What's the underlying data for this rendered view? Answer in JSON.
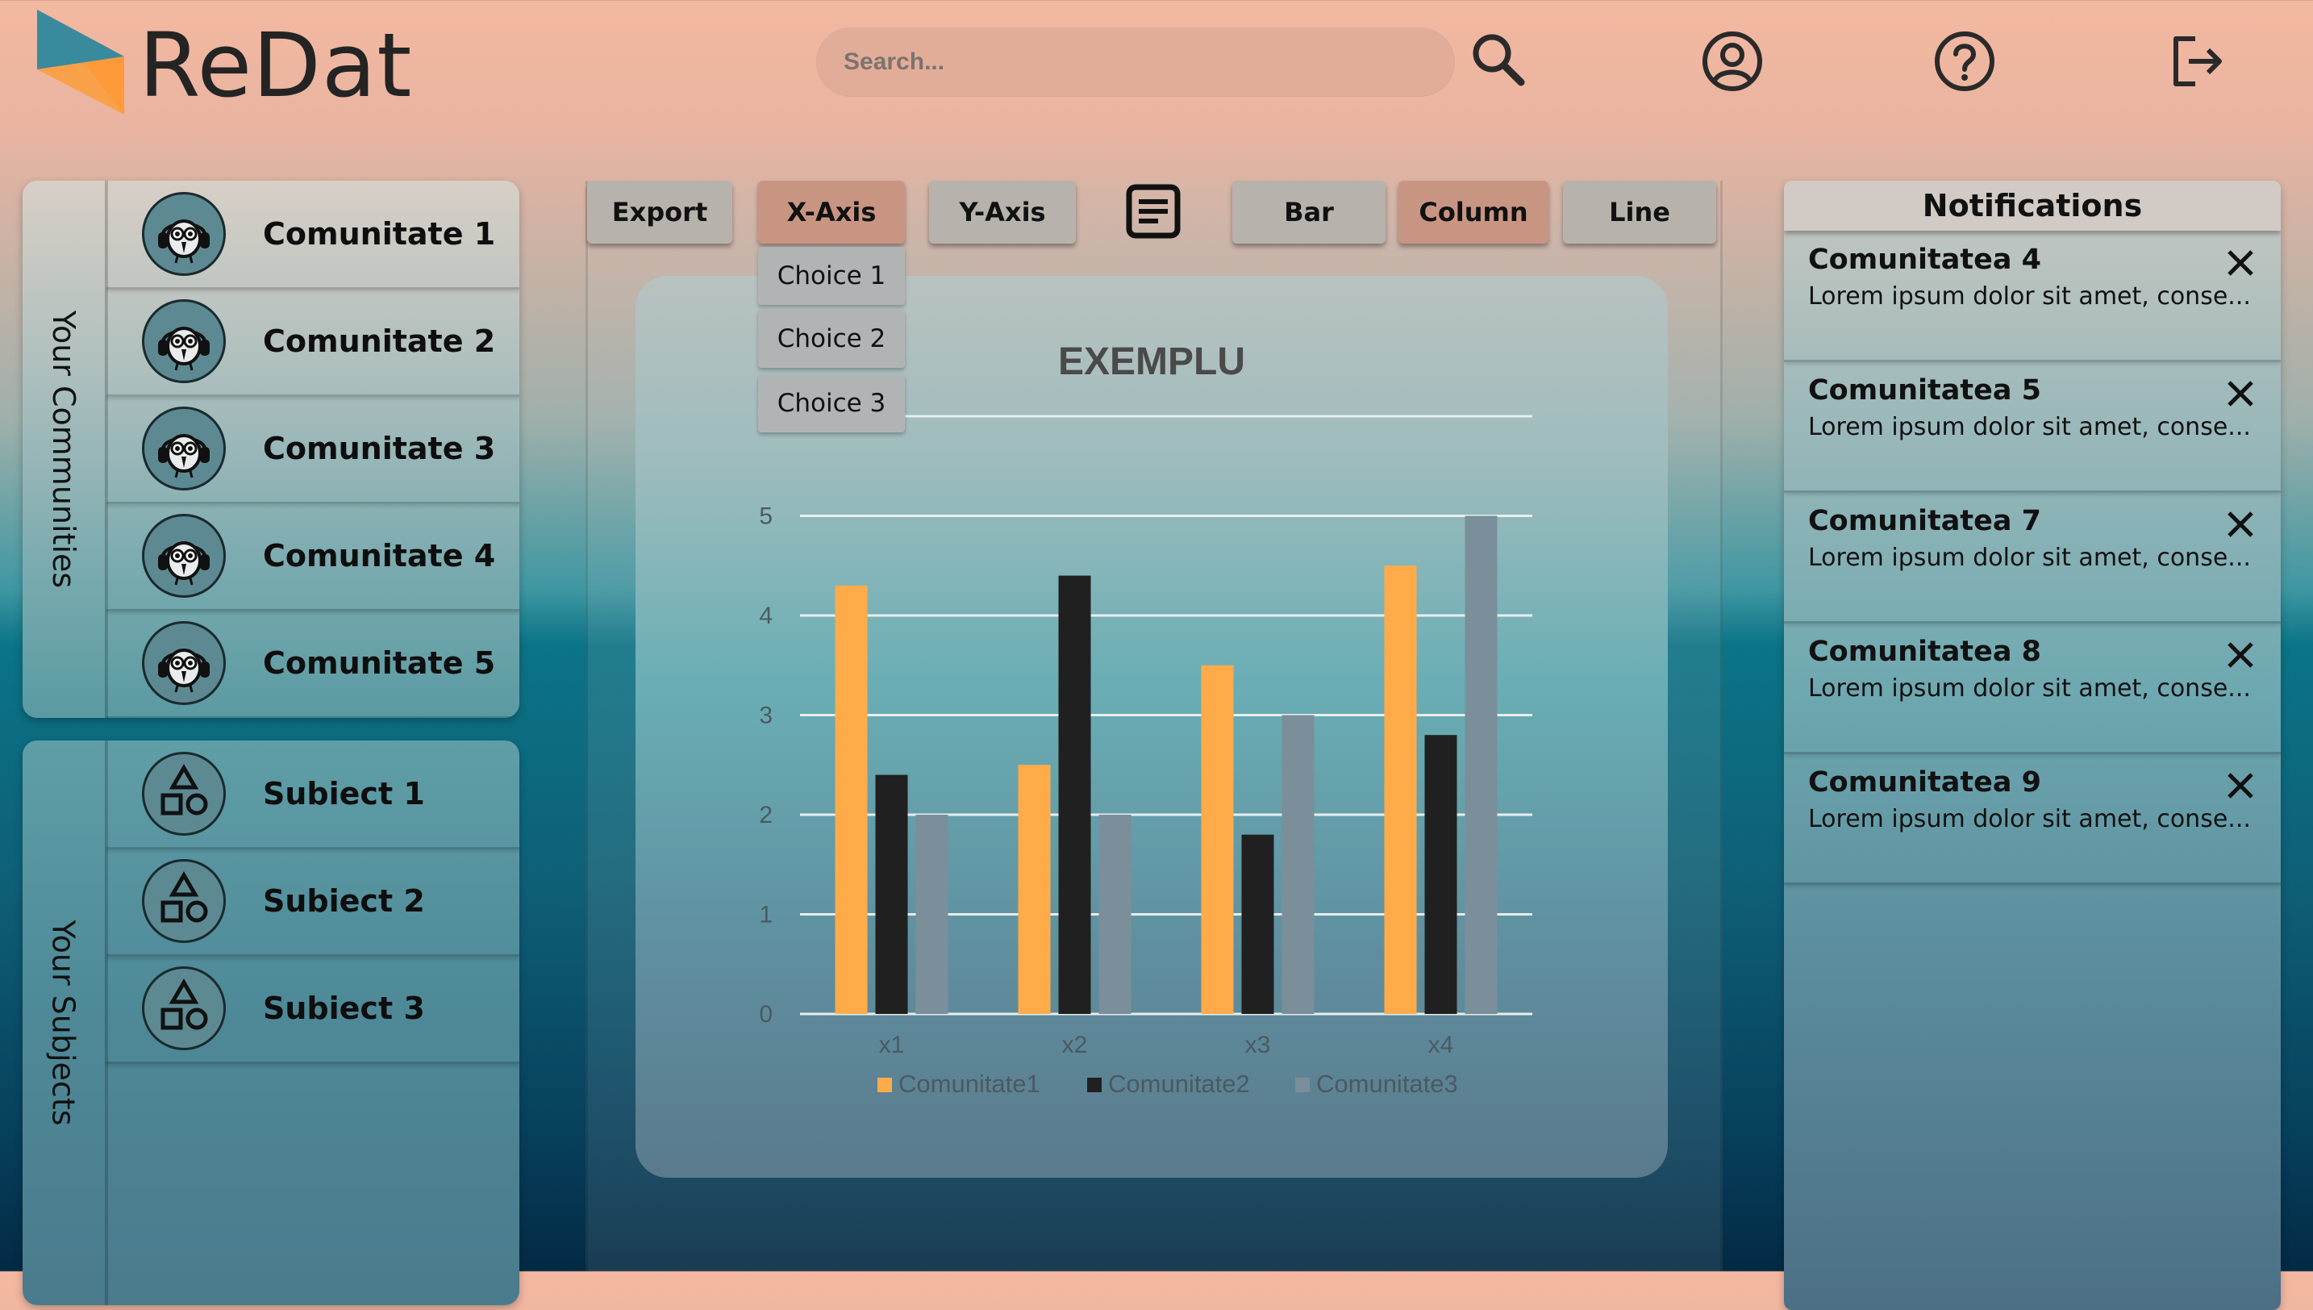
{
  "app": {
    "logo_text": "ReDat"
  },
  "header": {
    "search_placeholder": "Search...",
    "icons": [
      "search-icon",
      "user-profile-icon",
      "help-icon",
      "logout-icon"
    ]
  },
  "communities": {
    "title": "Your Communities",
    "items": [
      {
        "label": "Comunitate 1",
        "icon": "owl-headphones-icon"
      },
      {
        "label": "Comunitate 2",
        "icon": "owl-headphones-icon"
      },
      {
        "label": "Comunitate 3",
        "icon": "owl-headphones-icon"
      },
      {
        "label": "Comunitate 4",
        "icon": "owl-headphones-icon"
      },
      {
        "label": "Comunitate 5",
        "icon": "owl-headphones-icon"
      }
    ]
  },
  "subjects": {
    "title": "Your Subjects",
    "items": [
      {
        "label": "Subiect 1",
        "icon": "shapes-icon"
      },
      {
        "label": "Subiect 2",
        "icon": "shapes-icon"
      },
      {
        "label": "Subiect 3",
        "icon": "shapes-icon"
      }
    ]
  },
  "toolbar": {
    "export": "Export",
    "x_axis": "X-Axis",
    "y_axis": "Y-Axis",
    "bar": "Bar",
    "column": "Column",
    "line": "Line",
    "document_icon": "document-icon",
    "dropdown": [
      "Choice 1",
      "Choice 2",
      "Choice 3"
    ]
  },
  "notifications": {
    "title": "Notifications",
    "items": [
      {
        "title": "Comunitatea 4",
        "text": "Lorem ipsum dolor sit amet, conse..."
      },
      {
        "title": "Comunitatea 5",
        "text": "Lorem ipsum dolor sit amet, conse..."
      },
      {
        "title": "Comunitatea 7",
        "text": "Lorem ipsum dolor sit amet, conse..."
      },
      {
        "title": "Comunitatea 8",
        "text": "Lorem ipsum dolor sit amet, conse..."
      },
      {
        "title": "Comunitatea 9",
        "text": "Lorem ipsum dolor sit amet, conse..."
      }
    ]
  },
  "colors": {
    "accent": "#c99583",
    "series1": "#ffab4a",
    "series2": "#202020",
    "series3": "#7a8f99"
  },
  "chart_data": {
    "type": "bar",
    "title": "EXEMPLU",
    "categories": [
      "x1",
      "x2",
      "x3",
      "x4"
    ],
    "series": [
      {
        "name": "Comunitate1",
        "values": [
          4.3,
          2.5,
          3.5,
          4.5
        ]
      },
      {
        "name": "Comunitate2",
        "values": [
          2.4,
          4.4,
          1.8,
          2.8
        ]
      },
      {
        "name": "Comunitate3",
        "values": [
          2.0,
          2.0,
          3.0,
          5.0
        ]
      }
    ],
    "yticks": [
      "0",
      "1",
      "2",
      "3",
      "4",
      "5"
    ],
    "ylim": [
      0,
      6
    ],
    "grid": true,
    "legend": "bottom"
  }
}
